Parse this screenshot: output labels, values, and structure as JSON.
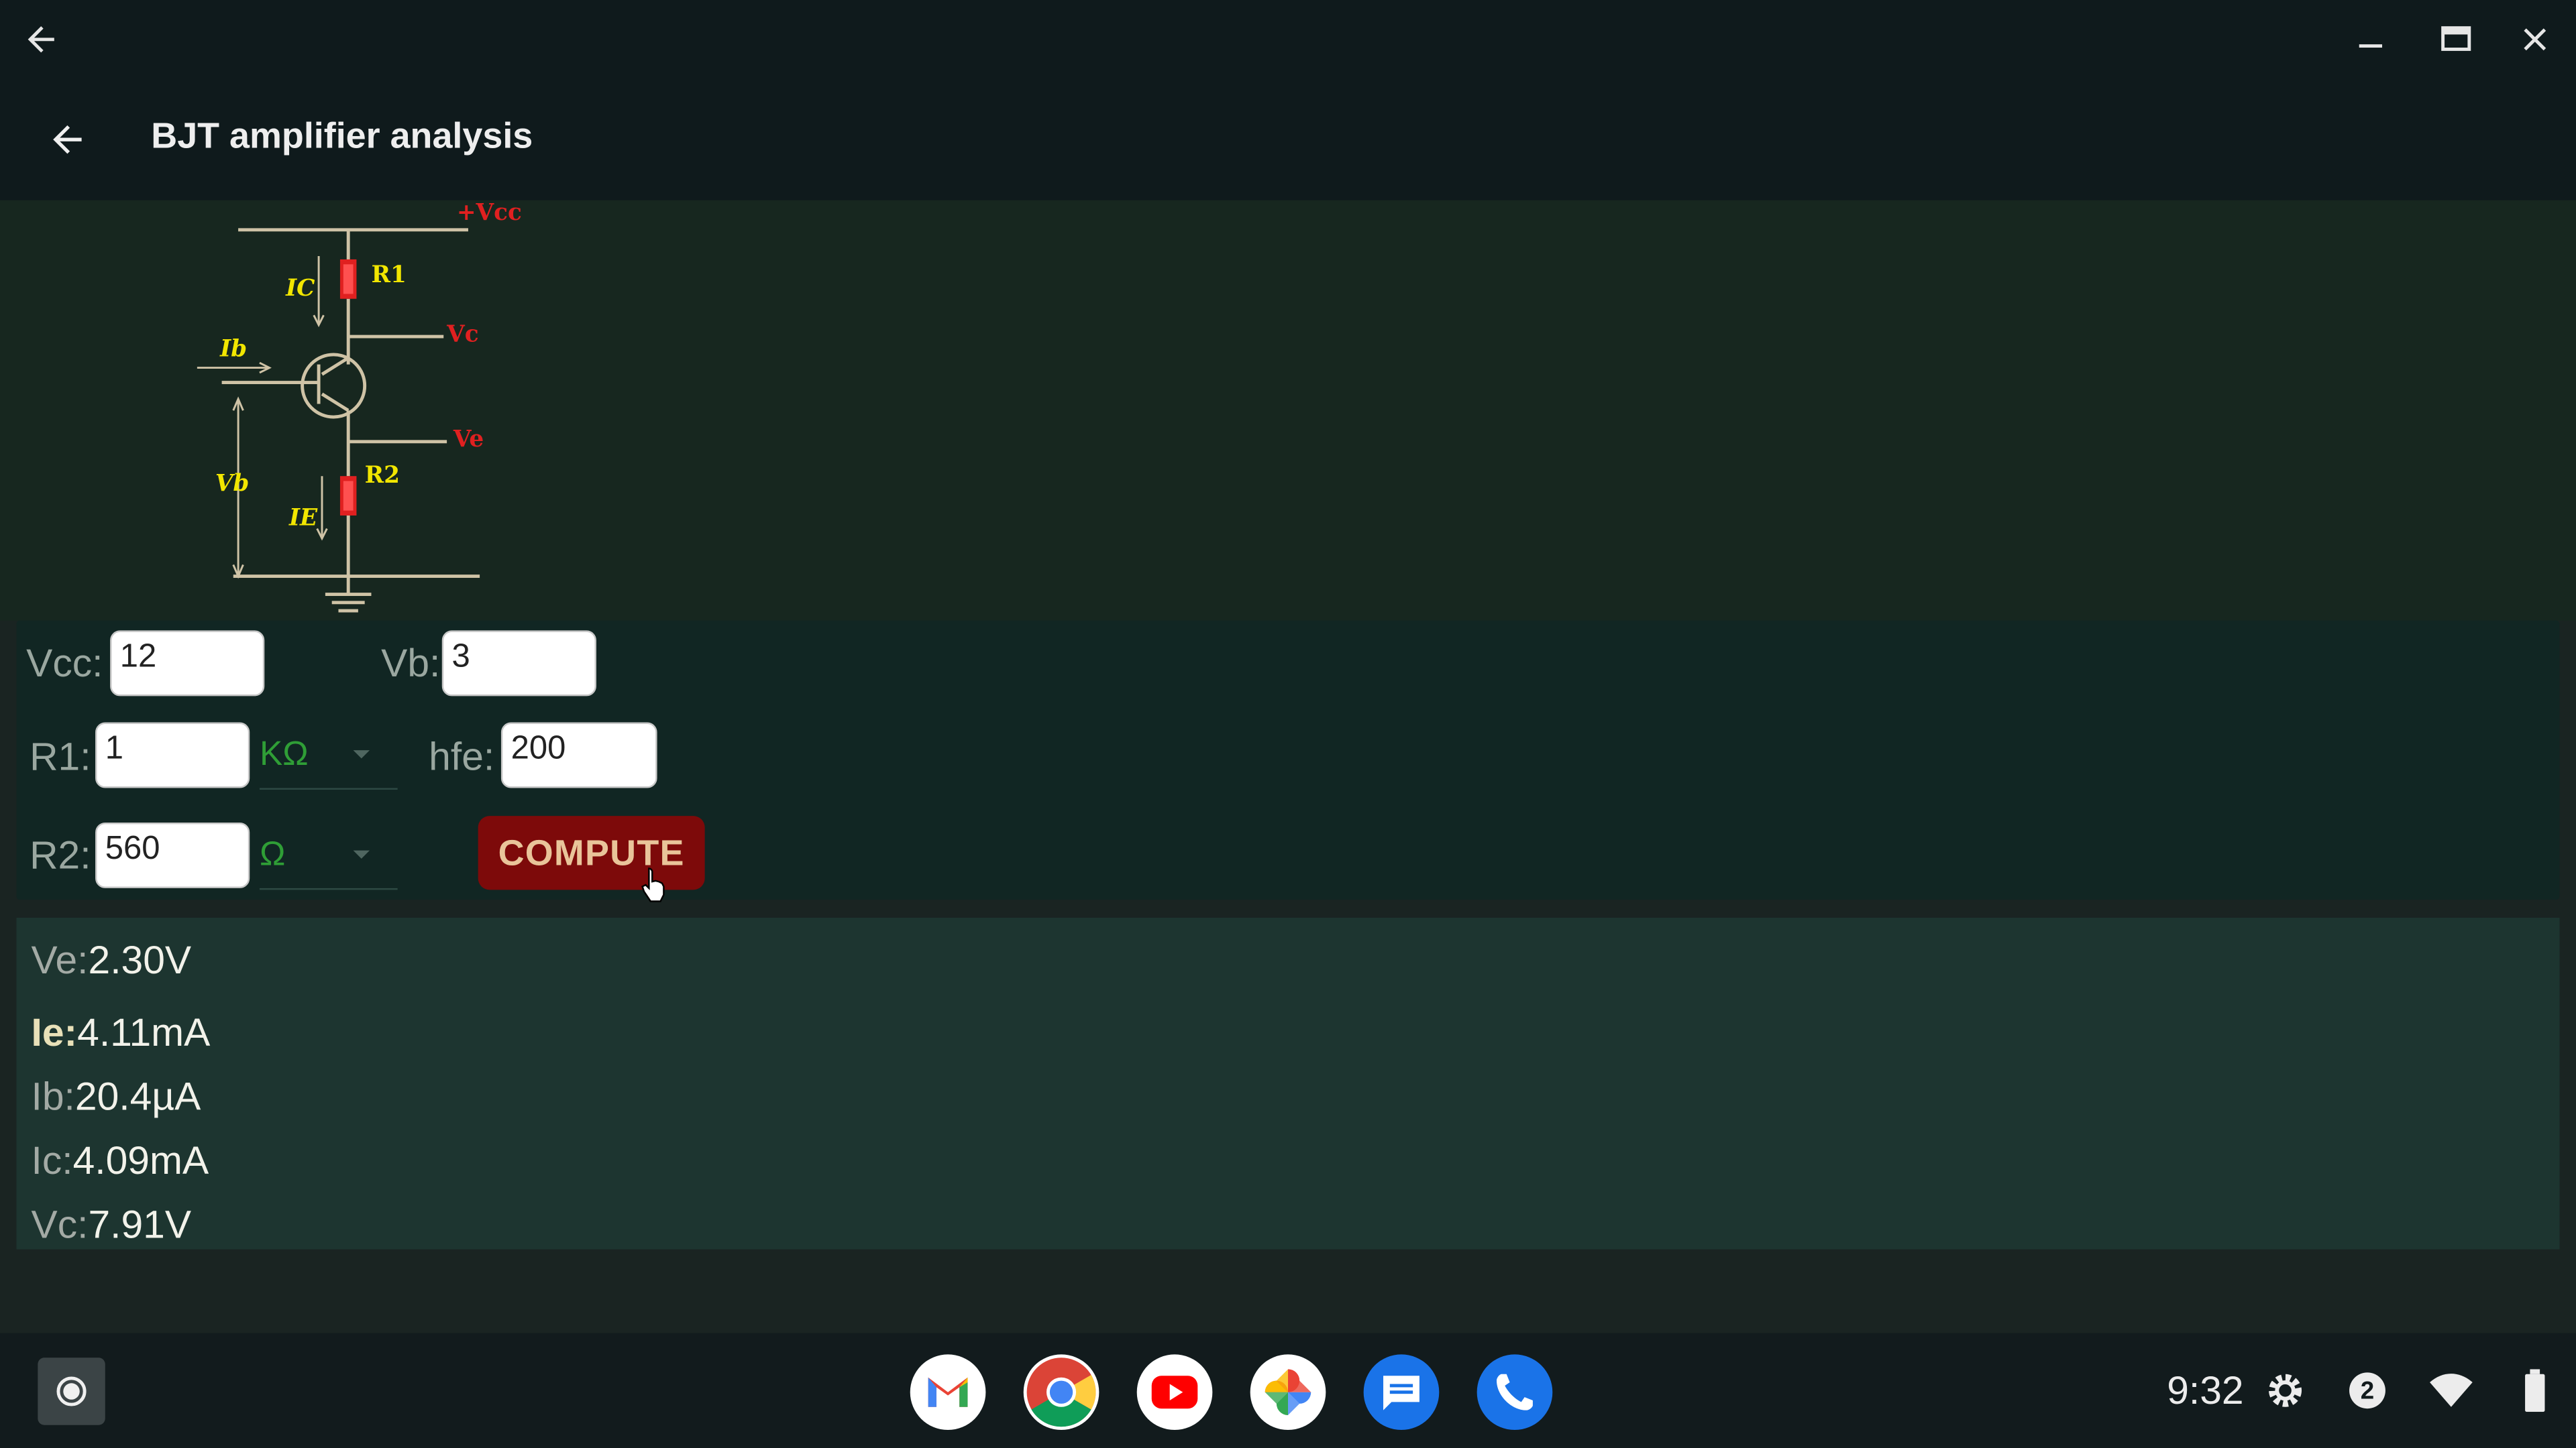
{
  "app": {
    "title": "BJT amplifier analysis"
  },
  "circuit": {
    "labels": {
      "vcc": "+Vcc",
      "r1": "R1",
      "r2": "R2",
      "vc": "Vc",
      "ve": "Ve",
      "vb": "Vb",
      "ib": "Ib",
      "ic": "IC",
      "ie": "IE"
    }
  },
  "inputs": {
    "vcc": {
      "label": "Vcc:",
      "value": "12"
    },
    "vb": {
      "label": "Vb:",
      "value": "3"
    },
    "r1": {
      "label": "R1:",
      "value": "1",
      "unit": "KΩ"
    },
    "hfe": {
      "label": "hfe:",
      "value": "200"
    },
    "r2": {
      "label": "R2:",
      "value": "560",
      "unit": "Ω"
    },
    "compute_label": "COMPUTE"
  },
  "results": [
    {
      "key": "Ve:",
      "value": "2.30V"
    },
    {
      "key": "Ie:",
      "value": "4.11mA"
    },
    {
      "key": "Ib:",
      "value": "20.4µA"
    },
    {
      "key": "Ic:",
      "value": "4.09mA"
    },
    {
      "key": "Vc:",
      "value": "7.91V"
    }
  ],
  "shelf": {
    "apps": [
      "Gmail",
      "Chrome",
      "YouTube",
      "Photos",
      "Messages",
      "Phone"
    ],
    "time": "9:32",
    "notification_count": "2"
  },
  "colors": {
    "accent_red": "#7d0a0a",
    "unit_green": "#2f9e36",
    "circuit_red": "#e02020",
    "circuit_yellow": "#f2e600"
  },
  "icons": [
    "back-arrow-icon",
    "minimize-icon",
    "maximize-icon",
    "close-icon",
    "launcher-icon",
    "settings-icon",
    "wifi-icon",
    "battery-icon"
  ]
}
